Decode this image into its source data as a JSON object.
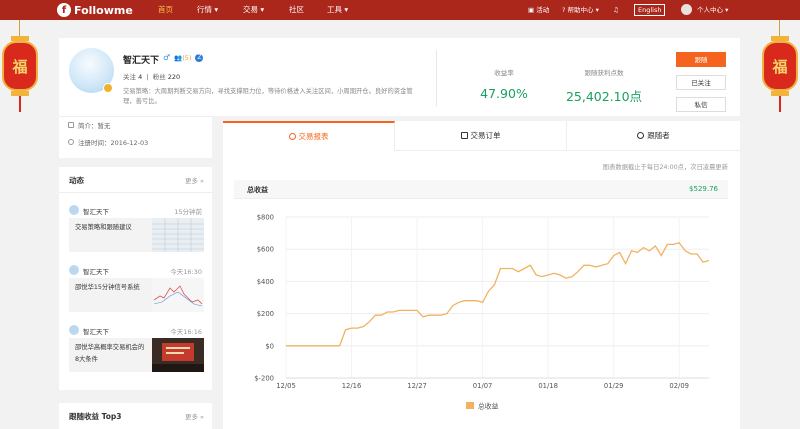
{
  "nav": {
    "logo_text": "Followme",
    "items": [
      {
        "label": "首页"
      },
      {
        "label": "行情 ▾"
      },
      {
        "label": "交易 ▾"
      },
      {
        "label": "社区"
      },
      {
        "label": "工具 ▾"
      }
    ],
    "right": {
      "activity": "活动",
      "help": "帮助中心 ▾",
      "lang": "English",
      "user": "个人中心 ▾"
    }
  },
  "lanterns": {
    "char": "福"
  },
  "profile": {
    "name": "智汇天下",
    "level_badge": "(5)",
    "follow_label": "关注",
    "follow_count": "4",
    "fans_label": "粉丝",
    "fans_count": "220",
    "strategy": "交易策略：大周期判断交易方向，寻找支撑阻力位，等待价格进入关注区间，小周期开仓。良好的资金管理，善亏比。",
    "stats": [
      {
        "label": "收益率",
        "value": "47.90%"
      },
      {
        "label": "跟随获利点数",
        "value": "25,402.10点"
      }
    ],
    "buttons": {
      "follow": "跟随",
      "followed": "已关注",
      "message": "私信"
    }
  },
  "info": {
    "intro": "简介：暂无",
    "registered": "注册时间：2016-12-03"
  },
  "dynamics": {
    "title": "动态",
    "more": "更多 »",
    "items": [
      {
        "author": "智汇天下",
        "time": "15分钟前",
        "text": "交易策略和跟随建议"
      },
      {
        "author": "智汇天下",
        "time": "今天16:30",
        "text": "邵悦华15分钟信号系统"
      },
      {
        "author": "智汇天下",
        "time": "今天16:16",
        "text": "邵悦华高概率交易机会的8大条件"
      }
    ]
  },
  "top3": {
    "title": "跟随收益 Top3",
    "more": "更多 »"
  },
  "tabs": [
    {
      "label": "交易报表"
    },
    {
      "label": "交易订单"
    },
    {
      "label": "跟随者"
    }
  ],
  "chart_header": {
    "note": "图表数据截止于每日24:00点，次日凌晨更新",
    "title": "总收益",
    "total": "$529.76"
  },
  "colors": {
    "nav_bg": "#ab261b",
    "accent": "#f5641e",
    "positive": "#19a15f",
    "line": "#f2b260"
  },
  "chart_data": {
    "type": "line",
    "title": "",
    "xlabel": "",
    "ylabel": "",
    "ylim": [
      -200,
      800
    ],
    "y_ticks": [
      "$-200",
      "$0",
      "$200",
      "$400",
      "$600",
      "$800"
    ],
    "x_ticks": [
      "12/05",
      "12/16",
      "12/27",
      "01/07",
      "01/18",
      "01/29",
      "02/09"
    ],
    "grid": true,
    "legend": "bottom",
    "series": [
      {
        "name": "总收益",
        "x": [
          "12/05",
          "12/06",
          "12/07",
          "12/08",
          "12/09",
          "12/10",
          "12/11",
          "12/12",
          "12/13",
          "12/14",
          "12/15",
          "12/16",
          "12/17",
          "12/18",
          "12/19",
          "12/20",
          "12/21",
          "12/22",
          "12/23",
          "12/24",
          "12/25",
          "12/26",
          "12/27",
          "12/28",
          "12/29",
          "12/30",
          "12/31",
          "01/01",
          "01/02",
          "01/03",
          "01/04",
          "01/05",
          "01/06",
          "01/07",
          "01/08",
          "01/09",
          "01/10",
          "01/11",
          "01/12",
          "01/13",
          "01/14",
          "01/15",
          "01/16",
          "01/17",
          "01/18",
          "01/19",
          "01/20",
          "01/21",
          "01/22",
          "01/23",
          "01/24",
          "01/25",
          "01/26",
          "01/27",
          "01/28",
          "01/29",
          "01/30",
          "01/31",
          "02/01",
          "02/02",
          "02/03",
          "02/04",
          "02/05",
          "02/06",
          "02/07",
          "02/08",
          "02/09",
          "02/10",
          "02/11",
          "02/12",
          "02/13",
          "02/14"
        ],
        "values": [
          0,
          0,
          0,
          0,
          0,
          0,
          0,
          0,
          0,
          0,
          100,
          110,
          110,
          120,
          150,
          190,
          190,
          210,
          210,
          220,
          220,
          220,
          220,
          180,
          190,
          190,
          190,
          200,
          250,
          270,
          280,
          280,
          280,
          270,
          340,
          380,
          480,
          480,
          480,
          460,
          480,
          500,
          440,
          430,
          440,
          450,
          440,
          420,
          430,
          460,
          500,
          500,
          490,
          500,
          510,
          560,
          580,
          510,
          590,
          580,
          610,
          590,
          620,
          560,
          630,
          630,
          640,
          590,
          570,
          570,
          520,
          530
        ]
      }
    ]
  }
}
